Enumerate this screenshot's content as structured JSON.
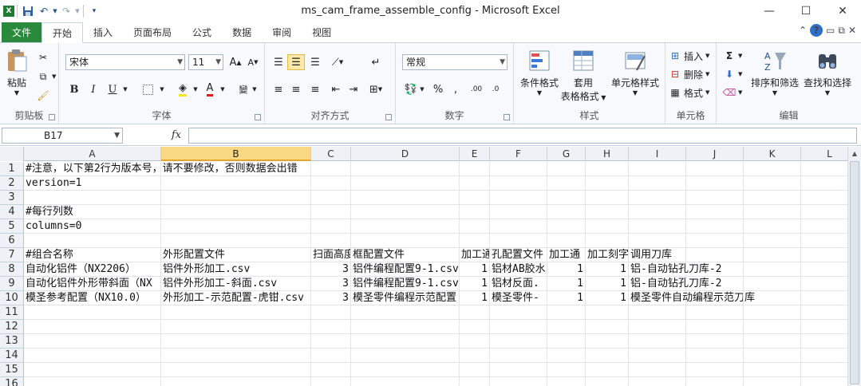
{
  "window": {
    "title": "ms_cam_frame_assemble_config  -  Microsoft Excel"
  },
  "qat": {
    "save_icon": "save-icon",
    "undo_icon": "undo-icon",
    "redo_icon": "redo-icon"
  },
  "tabs": {
    "file": "文件",
    "items": [
      "开始",
      "插入",
      "页面布局",
      "公式",
      "数据",
      "审阅",
      "视图"
    ]
  },
  "ribbon": {
    "clipboard": {
      "label": "剪贴板",
      "paste": "粘贴"
    },
    "font": {
      "label": "字体",
      "name": "宋体",
      "size": "11"
    },
    "alignment": {
      "label": "对齐方式"
    },
    "number": {
      "label": "数字",
      "format": "常规"
    },
    "styles": {
      "label": "样式",
      "conditional": "条件格式",
      "table1": "套用",
      "table2": "表格格式",
      "cell_styles": "单元格样式"
    },
    "cells": {
      "label": "单元格",
      "insert": "插入",
      "delete": "删除",
      "format": "格式"
    },
    "editing": {
      "label": "编辑",
      "sort": "排序和筛选",
      "find": "查找和选择"
    }
  },
  "formula_bar": {
    "name_box": "B17",
    "fx": "fx",
    "value": ""
  },
  "sheet": {
    "selected_column": "B",
    "columns": [
      "A",
      "B",
      "C",
      "D",
      "E",
      "F",
      "G",
      "H",
      "I",
      "J",
      "K",
      "L"
    ],
    "rows": [
      "1",
      "2",
      "3",
      "4",
      "5",
      "6",
      "7",
      "8",
      "9",
      "10",
      "11",
      "12",
      "13",
      "14",
      "15",
      "16"
    ],
    "cells": {
      "A1": "#注意，以下第2行为版本号，请不要修改，否则数据会出错",
      "A2": "version=1",
      "A4": "#每行列数",
      "A5": "columns=0",
      "A7": "#组合名称",
      "B7": "外形配置文件",
      "C7": "扫面高度",
      "D7": "框配置文件",
      "E7": "加工通",
      "F7": "孔配置文件",
      "G7": "加工通",
      "H7": "加工刻字",
      "I7": "调用刀库",
      "A8": "自动化铝件（NX2206）",
      "B8": "铝件外形加工.csv",
      "C8": "3",
      "D8": "铝件编程配置9-1.csv",
      "E8": "1",
      "F8": "铝材AB胶水",
      "G8": "1",
      "H8": "1",
      "I8": "铝-自动钻孔刀库-2",
      "A9": "自动化铝件外形带斜面（NX",
      "B9": "铝件外形加工-斜面.csv",
      "C9": "3",
      "D9": "铝件编程配置9-1.csv",
      "E9": "1",
      "F9": "铝材反面.",
      "G9": "1",
      "H9": "1",
      "I9": "铝-自动钻孔刀库-2",
      "A10": "模圣参考配置（NX10.0）",
      "B10": "外形加工-示范配置-虎钳.csv",
      "C10": "3",
      "D10": "模圣零件编程示范配置",
      "E10": "1",
      "F10": "模圣零件-",
      "G10": "1",
      "H10": "1",
      "I10": "模圣零件自动编程示范刀库"
    }
  }
}
